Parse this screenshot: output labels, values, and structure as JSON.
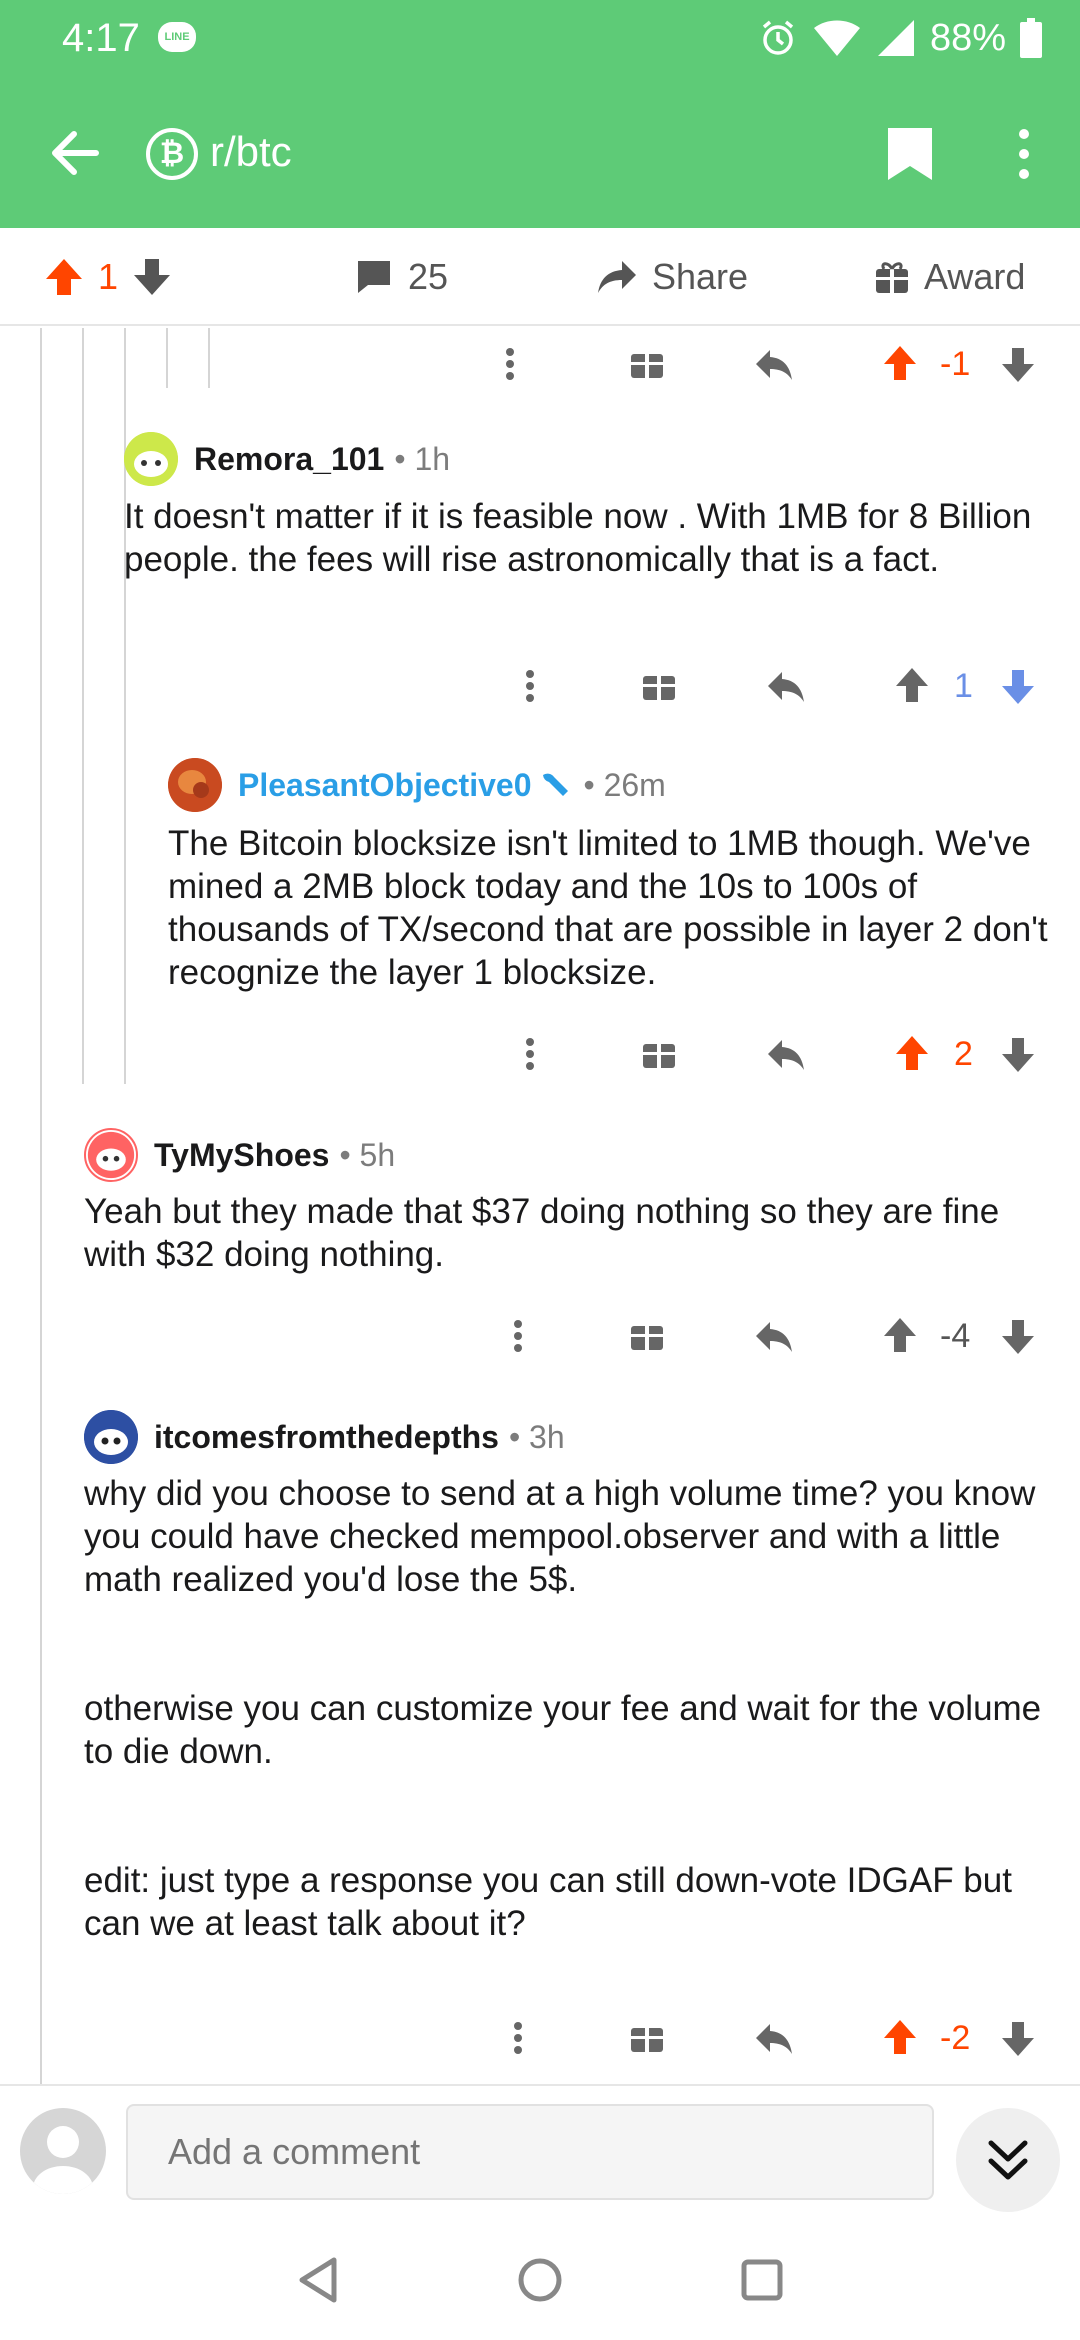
{
  "status": {
    "time": "4:17",
    "line_label": "LINE",
    "battery": "88%"
  },
  "header": {
    "subreddit": "r/btc",
    "sub_icon_glyph": "₿"
  },
  "post_actions": {
    "score": "1",
    "comments": "25",
    "share": "Share",
    "award": "Award"
  },
  "comments": [
    {
      "id": "top-partial",
      "score": "-1",
      "vote_state": "up"
    },
    {
      "id": "remora",
      "username": "Remora_101",
      "meta": "• 1h",
      "body": "It doesn't matter if it  is feasible now . With 1MB for 8 Billion people. the fees will rise astronomically that is a fact.",
      "score": "1",
      "vote_state": "down"
    },
    {
      "id": "pleasant",
      "username": "PleasantObjective0",
      "meta": "• 26m",
      "body": "The Bitcoin blocksize isn't limited to 1MB though. We've mined a 2MB block today and the 10s to 100s of thousands of TX/second that are possible in layer 2 don't recognize the layer 1 blocksize.",
      "score": "2",
      "vote_state": "up"
    },
    {
      "id": "tymyshoes",
      "username": "TyMyShoes",
      "meta": "• 5h",
      "body": "Yeah but they made that $37 doing nothing so they are fine with $32 doing nothing.",
      "score": "-4",
      "vote_state": "none"
    },
    {
      "id": "itcomes",
      "username": "itcomesfromthedepths",
      "meta": "• 3h",
      "body": "why did you choose to send at a high volume time? you know you could have checked mempool.observer and with a little math realized you'd lose the 5$.\n\n\notherwise you can customize your fee and wait for the volume to die down.\n\n\nedit: just type a response you can still down-vote IDGAF but can we at least talk about it?",
      "score": "-2",
      "vote_state": "up"
    }
  ],
  "composer": {
    "placeholder": "Add a comment"
  },
  "colors": {
    "header_bg": "#5ecb77",
    "upvote": "#ff4500",
    "downvote": "#6a8fe6",
    "op_name": "#2a9ee6"
  }
}
